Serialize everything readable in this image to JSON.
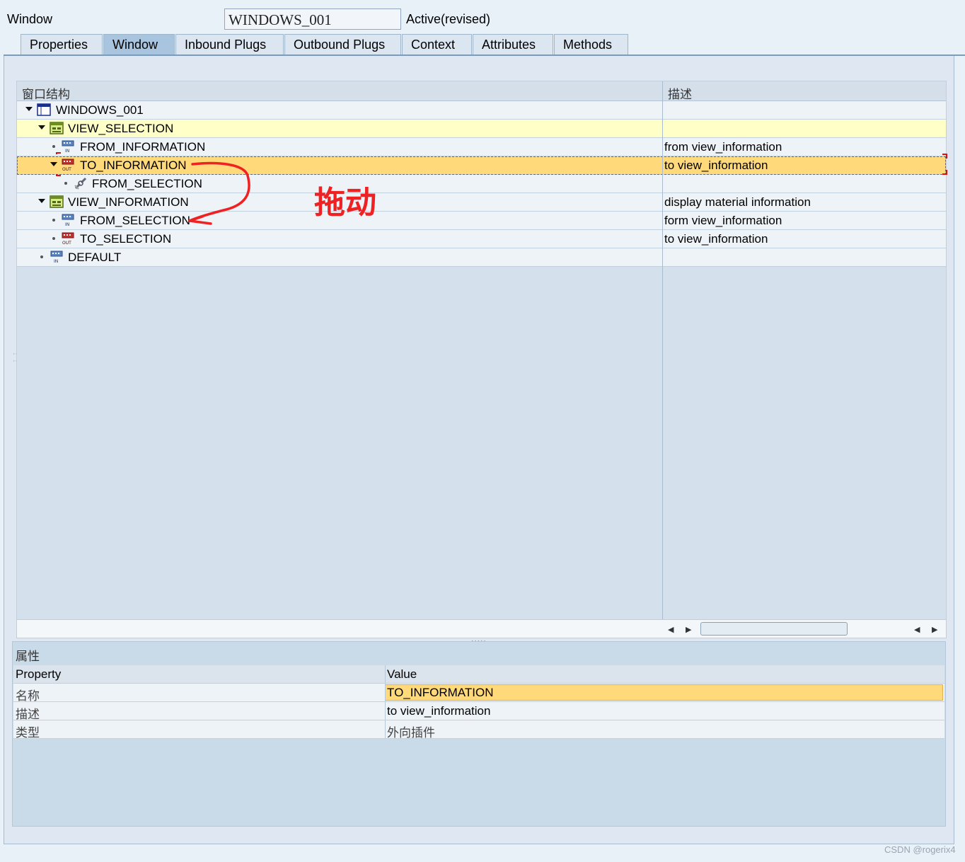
{
  "header": {
    "label": "Window",
    "name_value": "WINDOWS_001",
    "status": "Active(revised)"
  },
  "tabs": [
    {
      "label": "Properties"
    },
    {
      "label": "Window"
    },
    {
      "label": "Inbound Plugs"
    },
    {
      "label": "Outbound Plugs"
    },
    {
      "label": "Context"
    },
    {
      "label": "Attributes"
    },
    {
      "label": "Methods"
    }
  ],
  "active_tab": "Window",
  "tree": {
    "col_structure": "窗口结构",
    "col_desc": "描述",
    "rows": [
      {
        "name": "WINDOWS_001",
        "desc": "",
        "icon": "window-icon"
      },
      {
        "name": "VIEW_SELECTION",
        "desc": "",
        "icon": "view-icon"
      },
      {
        "name": "FROM_INFORMATION",
        "desc": "from view_information",
        "icon": "inbound-plug-icon"
      },
      {
        "name": "TO_INFORMATION",
        "desc": "to view_information",
        "icon": "outbound-plug-icon"
      },
      {
        "name": "FROM_SELECTION",
        "desc": "",
        "icon": "navigation-link-icon"
      },
      {
        "name": "VIEW_INFORMATION",
        "desc": "display material information",
        "icon": "view-icon"
      },
      {
        "name": "FROM_SELECTION",
        "desc": "form view_information",
        "icon": "inbound-plug-icon"
      },
      {
        "name": "TO_SELECTION",
        "desc": "to view_information",
        "icon": "outbound-plug-icon"
      },
      {
        "name": "DEFAULT",
        "desc": "",
        "icon": "inbound-plug-icon"
      }
    ]
  },
  "properties": {
    "title": "属性",
    "col_property": "Property",
    "col_value": "Value",
    "rows": [
      {
        "property": "名称",
        "value": "TO_INFORMATION"
      },
      {
        "property": "描述",
        "value": "to view_information"
      },
      {
        "property": "类型",
        "value": "外向插件"
      }
    ]
  },
  "annotation": {
    "text": "拖动",
    "color": "#ee2222"
  },
  "watermark": "CSDN @rogerix4",
  "colors": {
    "selected_row": "#ffd97a",
    "view_row": "#ffffc8",
    "tab_active": "#a9c4de",
    "panel_bg": "#d4e1ed"
  }
}
